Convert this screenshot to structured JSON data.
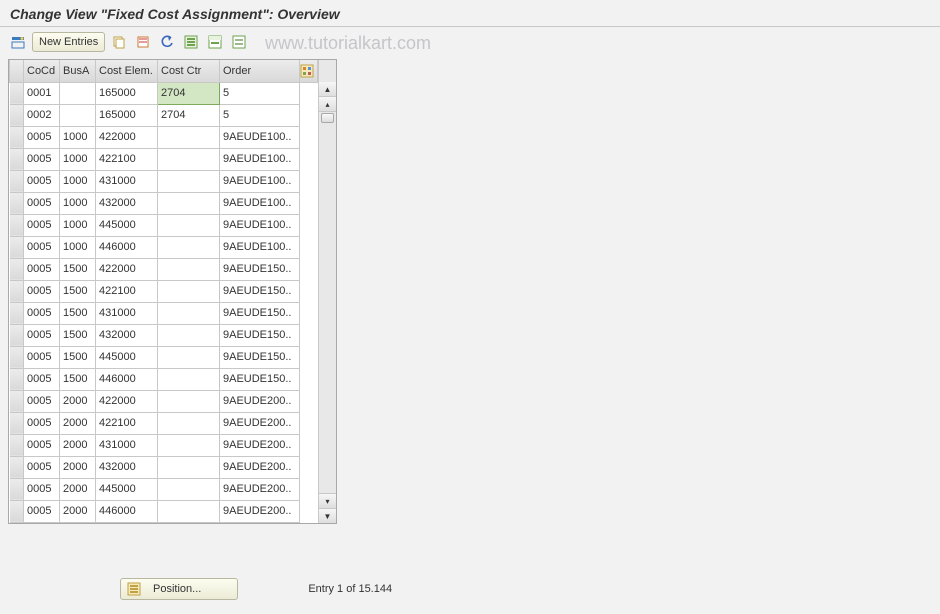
{
  "title": "Change View \"Fixed Cost Assignment\": Overview",
  "watermark": "www.tutorialkart.com",
  "toolbar": {
    "new_entries_label": "New Entries"
  },
  "table": {
    "headers": {
      "cocd": "CoCd",
      "busa": "BusA",
      "cost_elem": "Cost Elem.",
      "cost_ctr": "Cost Ctr",
      "order": "Order"
    },
    "rows": [
      {
        "cocd": "0001",
        "busa": "",
        "cost_elem": "165000",
        "cost_ctr": "2704",
        "order": "5"
      },
      {
        "cocd": "0002",
        "busa": "",
        "cost_elem": "165000",
        "cost_ctr": "2704",
        "order": "5"
      },
      {
        "cocd": "0005",
        "busa": "1000",
        "cost_elem": "422000",
        "cost_ctr": "",
        "order": "9AEUDE100.."
      },
      {
        "cocd": "0005",
        "busa": "1000",
        "cost_elem": "422100",
        "cost_ctr": "",
        "order": "9AEUDE100.."
      },
      {
        "cocd": "0005",
        "busa": "1000",
        "cost_elem": "431000",
        "cost_ctr": "",
        "order": "9AEUDE100.."
      },
      {
        "cocd": "0005",
        "busa": "1000",
        "cost_elem": "432000",
        "cost_ctr": "",
        "order": "9AEUDE100.."
      },
      {
        "cocd": "0005",
        "busa": "1000",
        "cost_elem": "445000",
        "cost_ctr": "",
        "order": "9AEUDE100.."
      },
      {
        "cocd": "0005",
        "busa": "1000",
        "cost_elem": "446000",
        "cost_ctr": "",
        "order": "9AEUDE100.."
      },
      {
        "cocd": "0005",
        "busa": "1500",
        "cost_elem": "422000",
        "cost_ctr": "",
        "order": "9AEUDE150.."
      },
      {
        "cocd": "0005",
        "busa": "1500",
        "cost_elem": "422100",
        "cost_ctr": "",
        "order": "9AEUDE150.."
      },
      {
        "cocd": "0005",
        "busa": "1500",
        "cost_elem": "431000",
        "cost_ctr": "",
        "order": "9AEUDE150.."
      },
      {
        "cocd": "0005",
        "busa": "1500",
        "cost_elem": "432000",
        "cost_ctr": "",
        "order": "9AEUDE150.."
      },
      {
        "cocd": "0005",
        "busa": "1500",
        "cost_elem": "445000",
        "cost_ctr": "",
        "order": "9AEUDE150.."
      },
      {
        "cocd": "0005",
        "busa": "1500",
        "cost_elem": "446000",
        "cost_ctr": "",
        "order": "9AEUDE150.."
      },
      {
        "cocd": "0005",
        "busa": "2000",
        "cost_elem": "422000",
        "cost_ctr": "",
        "order": "9AEUDE200.."
      },
      {
        "cocd": "0005",
        "busa": "2000",
        "cost_elem": "422100",
        "cost_ctr": "",
        "order": "9AEUDE200.."
      },
      {
        "cocd": "0005",
        "busa": "2000",
        "cost_elem": "431000",
        "cost_ctr": "",
        "order": "9AEUDE200.."
      },
      {
        "cocd": "0005",
        "busa": "2000",
        "cost_elem": "432000",
        "cost_ctr": "",
        "order": "9AEUDE200.."
      },
      {
        "cocd": "0005",
        "busa": "2000",
        "cost_elem": "445000",
        "cost_ctr": "",
        "order": "9AEUDE200.."
      },
      {
        "cocd": "0005",
        "busa": "2000",
        "cost_elem": "446000",
        "cost_ctr": "",
        "order": "9AEUDE200.."
      }
    ],
    "selected_row": 0,
    "selected_col": "cost_ctr"
  },
  "footer": {
    "position_label": "Position...",
    "status": "Entry 1 of 15.144"
  }
}
